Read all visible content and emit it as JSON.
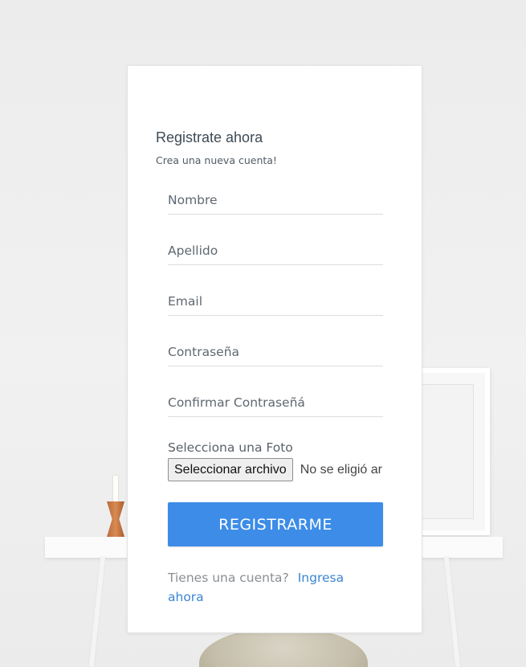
{
  "form": {
    "title": "Registrate ahora",
    "subtitle": "Crea una nueva cuenta!",
    "fields": {
      "nombre": "Nombre",
      "apellido": "Apellido",
      "email": "Email",
      "password": "Contraseña",
      "confirm_password": "Confirmar Contraseñá"
    },
    "photo_label": "Selecciona una Foto",
    "file_button": "Seleccionar archivo",
    "file_status": "No se eligió ar",
    "submit_label": "REGISTRARME",
    "login_prompt": "Tienes una cuenta?",
    "login_link": "Ingresa ahora"
  },
  "colors": {
    "accent": "#3c8ce8",
    "link": "#3a86d4",
    "background": "#eeeeee"
  }
}
